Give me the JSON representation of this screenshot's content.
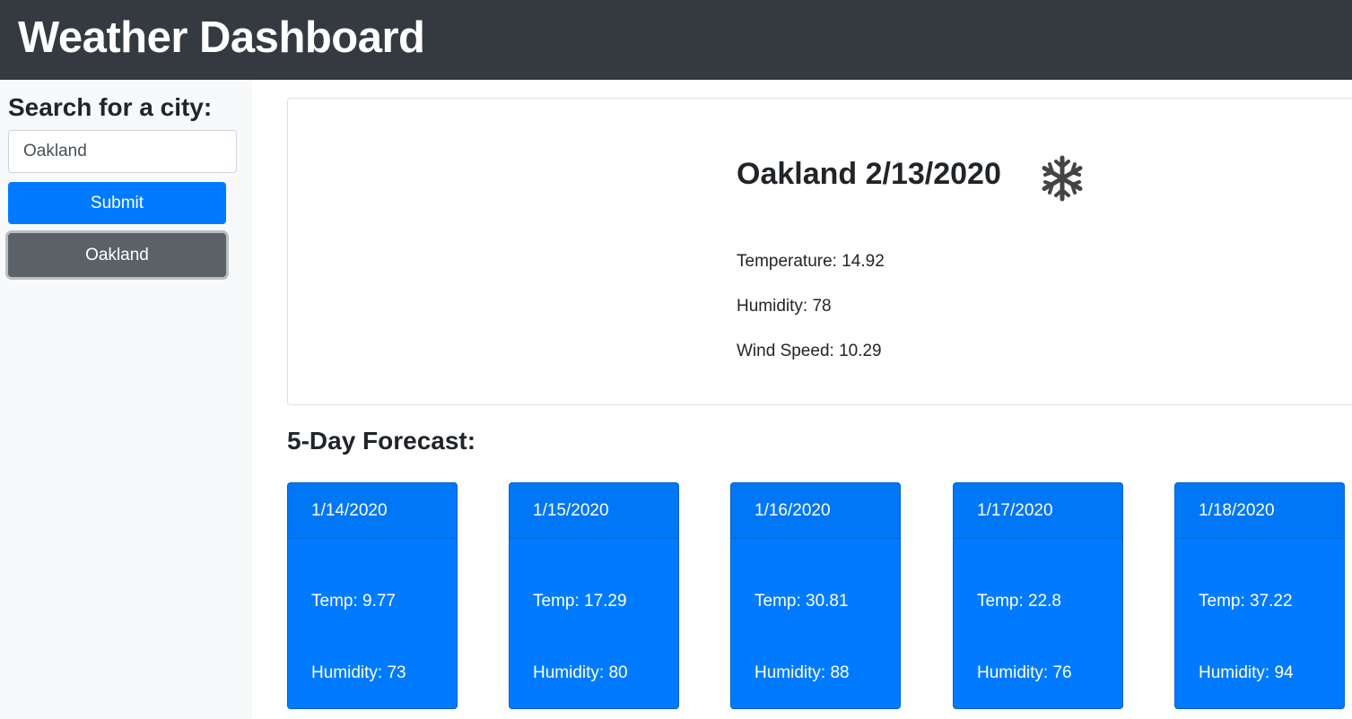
{
  "header": {
    "title": "Weather Dashboard"
  },
  "sidebar": {
    "search_label": "Search for a city:",
    "search_value": "Oakland",
    "submit_label": "Submit",
    "history": [
      "Oakland"
    ]
  },
  "current": {
    "title": "Oakland 2/13/2020",
    "icon": "snowflake-icon",
    "temperature": "Temperature: 14.92",
    "humidity": "Humidity: 78",
    "wind": "Wind Speed: 10.29"
  },
  "forecast": {
    "title": "5-Day Forecast:",
    "days": [
      {
        "date": "1/14/2020",
        "temp": "Temp: 9.77",
        "humidity": "Humidity: 73"
      },
      {
        "date": "1/15/2020",
        "temp": "Temp: 17.29",
        "humidity": "Humidity: 80"
      },
      {
        "date": "1/16/2020",
        "temp": "Temp: 30.81",
        "humidity": "Humidity: 88"
      },
      {
        "date": "1/17/2020",
        "temp": "Temp: 22.8",
        "humidity": "Humidity: 76"
      },
      {
        "date": "1/18/2020",
        "temp": "Temp: 37.22",
        "humidity": "Humidity: 94"
      }
    ]
  },
  "colors": {
    "header_bg": "#343a40",
    "primary": "#007bff",
    "secondary": "#5a6268",
    "sidebar_bg": "#f8f9fa"
  }
}
